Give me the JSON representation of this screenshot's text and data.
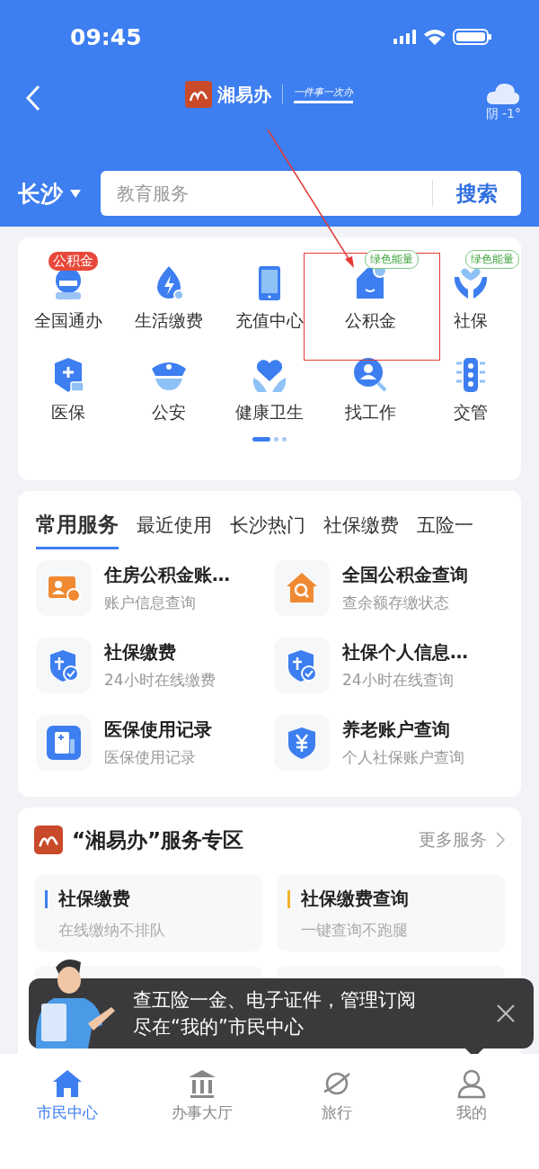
{
  "status_bar": {
    "time": "09:45"
  },
  "header": {
    "logo_text": "湘易办",
    "slogan": "一件事一次办",
    "weather": "阴 -1°"
  },
  "search": {
    "city": "长沙",
    "placeholder": "教育服务",
    "button": "搜索"
  },
  "grid": {
    "items": [
      {
        "label": "全国通办",
        "badge": {
          "text": "公积金",
          "kind": "red"
        }
      },
      {
        "label": "生活缴费"
      },
      {
        "label": "充值中心"
      },
      {
        "label": "公积金",
        "badge": {
          "text": "绿色能量",
          "kind": "green"
        }
      },
      {
        "label": "社保",
        "badge": {
          "text": "绿色能量",
          "kind": "green"
        }
      },
      {
        "label": "医保"
      },
      {
        "label": "公安"
      },
      {
        "label": "健康卫生"
      },
      {
        "label": "找工作"
      },
      {
        "label": "交管"
      }
    ],
    "pages": [
      {
        "selected": true
      },
      {
        "selected": false
      },
      {
        "selected": false
      }
    ]
  },
  "tabs": [
    {
      "label": "常用服务",
      "selected": true
    },
    {
      "label": "最近使用",
      "selected": false
    },
    {
      "label": "长沙热门",
      "selected": false
    },
    {
      "label": "社保缴费",
      "selected": false
    },
    {
      "label": "五险一",
      "selected": false
    }
  ],
  "services": [
    {
      "title": "住房公积金账…",
      "subtitle": "账户信息查询"
    },
    {
      "title": "全国公积金查询",
      "subtitle": "查余额存缴状态"
    },
    {
      "title": "社保缴费",
      "subtitle": "24小时在线缴费"
    },
    {
      "title": "社保个人信息…",
      "subtitle": "24小时在线查询"
    },
    {
      "title": "医保使用记录",
      "subtitle": "医保使用记录"
    },
    {
      "title": "养老账户查询",
      "subtitle": "个人社保账户查询"
    }
  ],
  "zone": {
    "title": "“湘易办”服务专区",
    "more": "更多服务",
    "cards": [
      {
        "title": "社保缴费",
        "subtitle": "在线缴纳不排队",
        "color": "#3d7ef0"
      },
      {
        "title": "社保缴费查询",
        "subtitle": "一键查询不跑腿",
        "color": "#f0b429"
      }
    ]
  },
  "toast": {
    "lines": [
      "查五险一金、电子证件，管理订阅",
      "尽在“我的”市民中心"
    ]
  },
  "nav": [
    {
      "label": "市民中心",
      "selected": true
    },
    {
      "label": "办事大厅",
      "selected": false
    },
    {
      "label": "旅行",
      "selected": false
    },
    {
      "label": "我的",
      "selected": false
    }
  ]
}
